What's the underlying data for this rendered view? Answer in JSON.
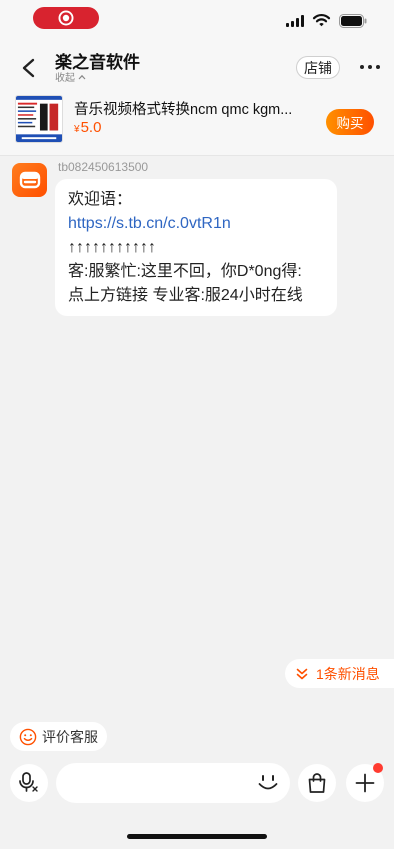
{
  "header": {
    "title": "楽之音软件",
    "collapse_label": "收起",
    "shop_label": "店铺"
  },
  "product": {
    "title": "音乐视频格式转换ncm qmc kgm...",
    "price_symbol": "¥",
    "price": "5.0",
    "buy_label": "购买"
  },
  "chat": {
    "messages": [
      {
        "sender": "tb082450613500",
        "lines": [
          "欢迎语：",
          "https://s.tb.cn/c.0vtR1n",
          "↑↑↑↑↑↑↑↑↑↑↑",
          "客:服繁忙:这里不回，你D*0ng得:",
          "点上方链接 专业客:服24小时在线"
        ]
      }
    ],
    "new_messages_label": "1条新消息",
    "rate_service_label": "评价客服"
  },
  "input_bar": {
    "message_value": "",
    "has_unread_badge": true
  },
  "icons": {
    "recording": "record-icon",
    "signal": "signal-icon",
    "wifi": "wifi-icon",
    "battery": "battery-icon",
    "back": "back-chevron-icon",
    "collapse": "chevron-up-icon",
    "more": "more-icon",
    "avatar": "shop-service-icon",
    "new_messages": "double-chevron-down-icon",
    "rate": "smiley-icon",
    "voice": "mic-icon",
    "emoji": "emoji-icon",
    "order": "shopping-bag-icon",
    "add": "plus-icon"
  },
  "colors": {
    "accent": "#ff5000",
    "link": "#2f66c2",
    "recording": "#d8232f",
    "badge": "#ff3b30"
  }
}
